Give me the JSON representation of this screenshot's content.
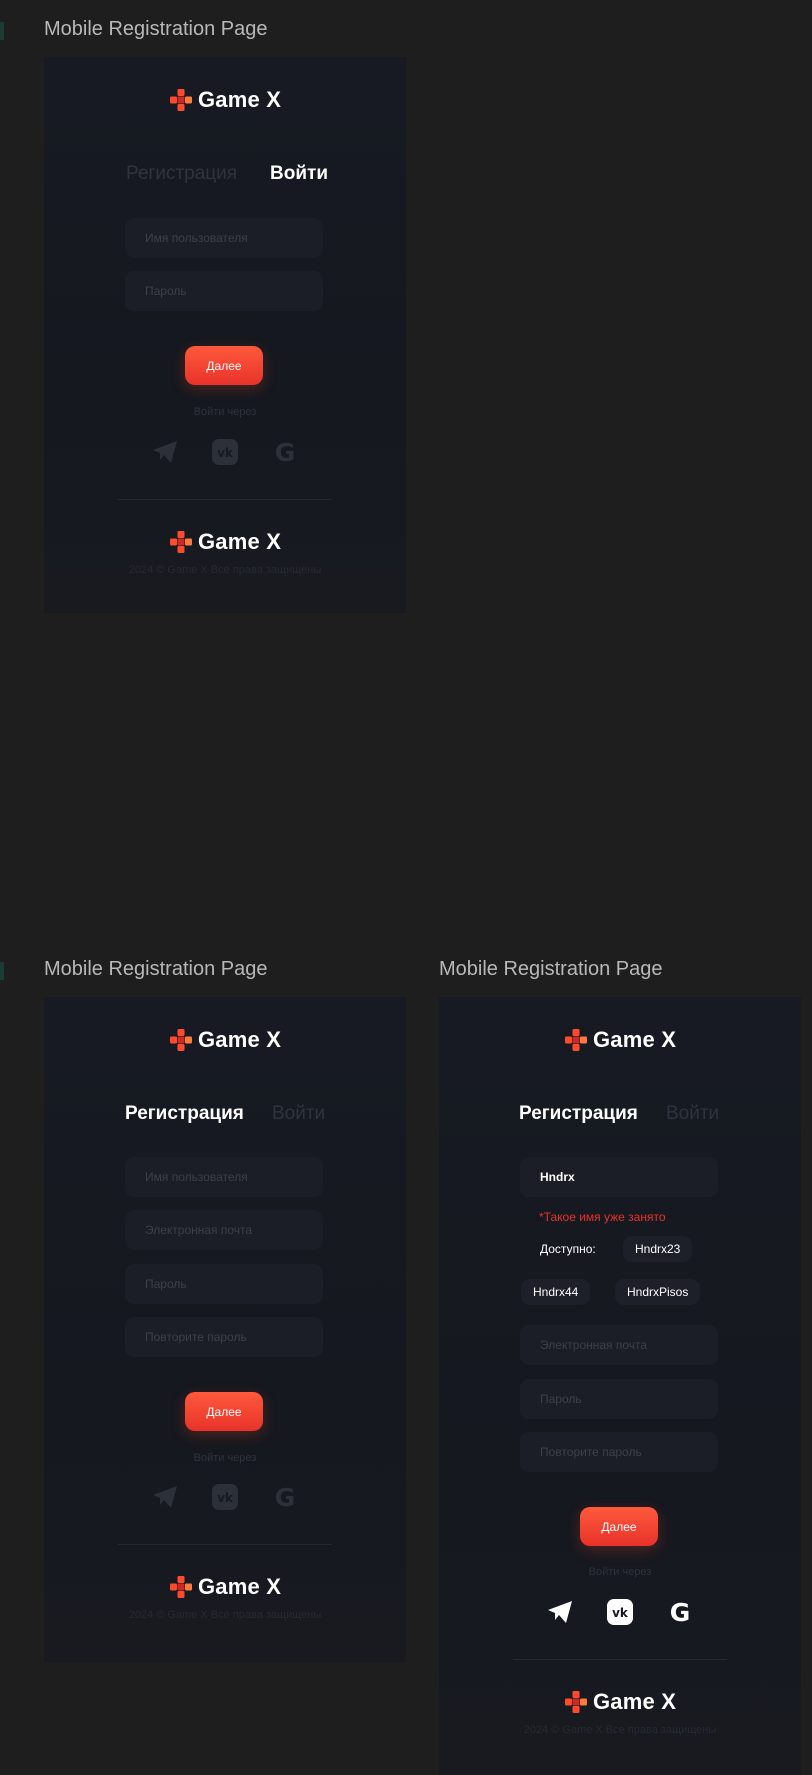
{
  "brand": {
    "name": "Game X",
    "accent": "#ff4a2e"
  },
  "frames": [
    {
      "label": "Mobile Registration Page",
      "tabs": {
        "register": "Регистрация",
        "login": "Войти",
        "active": "login"
      },
      "fields": [
        {
          "placeholder": "Имя пользователя",
          "value": ""
        },
        {
          "placeholder": "Пароль",
          "value": ""
        }
      ],
      "next_label": "Далее",
      "via_label": "Войти через",
      "social": [
        "telegram-icon",
        "vk-icon",
        "google-icon"
      ],
      "footer_brand": "Game X",
      "copyright": "2024 © Game X Все права защищены"
    },
    {
      "label": "Mobile Registration Page",
      "tabs": {
        "register": "Регистрация",
        "login": "Войти",
        "active": "register"
      },
      "fields": [
        {
          "placeholder": "Имя пользователя",
          "value": ""
        },
        {
          "placeholder": "Электронная почта",
          "value": ""
        },
        {
          "placeholder": "Пароль",
          "value": ""
        },
        {
          "placeholder": "Повторите пароль",
          "value": ""
        }
      ],
      "next_label": "Далее",
      "via_label": "Войти через",
      "social": [
        "telegram-icon",
        "vk-icon",
        "google-icon"
      ],
      "footer_brand": "Game X",
      "copyright": "2024 © Game X Все права защищены"
    },
    {
      "label": "Mobile Registration Page",
      "tabs": {
        "register": "Регистрация",
        "login": "Войти",
        "active": "register"
      },
      "fields": [
        {
          "placeholder": "Имя пользователя",
          "value": "Hndrx"
        },
        {
          "placeholder": "Электронная почта",
          "value": ""
        },
        {
          "placeholder": "Пароль",
          "value": ""
        },
        {
          "placeholder": "Повторите пароль",
          "value": ""
        }
      ],
      "error": "*Такое имя уже занято",
      "available_label": "Доступно:",
      "suggestions": [
        "Hndrx23",
        "Hndrx44",
        "HndrxPisos"
      ],
      "next_label": "Далее",
      "via_label": "Войти через",
      "social": [
        "telegram-icon",
        "vk-icon",
        "google-icon"
      ],
      "social_active": true,
      "footer_brand": "Game X",
      "copyright": "2024 © Game X Все права защищены"
    }
  ]
}
